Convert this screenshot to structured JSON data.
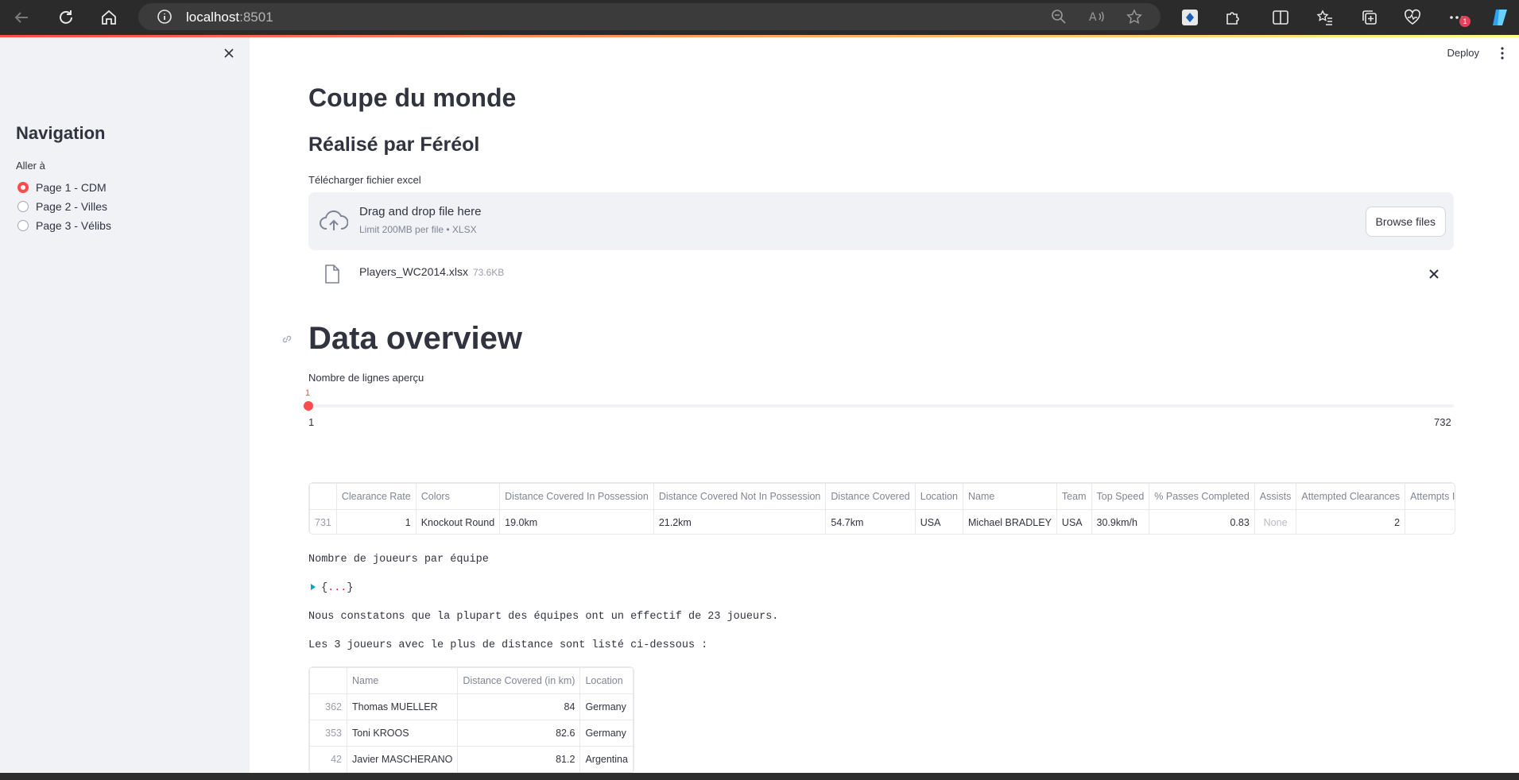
{
  "browser": {
    "url_host": "localhost",
    "url_port": ":8501",
    "badge": "1"
  },
  "header": {
    "deploy_label": "Deploy"
  },
  "sidebar": {
    "title": "Navigation",
    "radio_label": "Aller à",
    "options": [
      {
        "label": "Page 1 - CDM",
        "selected": true
      },
      {
        "label": "Page 2 - Villes",
        "selected": false
      },
      {
        "label": "Page 3 - Vélibs",
        "selected": false
      }
    ]
  },
  "main": {
    "title": "Coupe du monde",
    "subtitle": "Réalisé par Féréol",
    "uploader": {
      "label": "Télécharger fichier excel",
      "title": "Drag and drop file here",
      "subtitle": "Limit 200MB per file • XLSX",
      "button": "Browse files",
      "file_name": "Players_WC2014.xlsx",
      "file_size": "73.6KB"
    },
    "section_title": "Data overview",
    "slider": {
      "label": "Nombre de lignes aperçu",
      "value": "1",
      "min": "1",
      "max": "732"
    },
    "overview_table": {
      "columns": [
        "",
        "Clearance Rate",
        "Colors",
        "Distance Covered In Possession",
        "Distance Covered Not In Possession",
        "Distance Covered",
        "Location",
        "Name",
        "Team",
        "Top Speed",
        "% Passes Completed",
        "Assists",
        "Attempted Clearances",
        "Attempts In"
      ],
      "rows": [
        [
          "731",
          "1",
          "Knockout Round",
          "19.0km",
          "21.2km",
          "54.7km",
          "USA",
          "Michael BRADLEY",
          "USA",
          "30.9km/h",
          "0.83",
          "None",
          "2",
          ""
        ]
      ]
    },
    "text_players_per_team": "Nombre de joueurs par équipe",
    "json_collapsed": "{...}",
    "text_conclusion": "Nous constatons que la plupart des équipes ont un effectif de 23 joueurs.",
    "text_top3": "Les 3 joueurs avec le plus de distance sont listé ci-dessous :",
    "top_table": {
      "columns": [
        "",
        "Name",
        "Distance Covered (in km)",
        "Location"
      ],
      "rows": [
        [
          "362",
          "Thomas MUELLER",
          "84",
          "Germany"
        ],
        [
          "353",
          "Toni KROOS",
          "82.6",
          "Germany"
        ],
        [
          "42",
          "Javier MASCHERANO",
          "81.2",
          "Argentina"
        ]
      ]
    }
  },
  "colors": {
    "accent": "#ff4b4b",
    "sidebar_bg": "#f0f2f6",
    "text": "#31333f"
  }
}
